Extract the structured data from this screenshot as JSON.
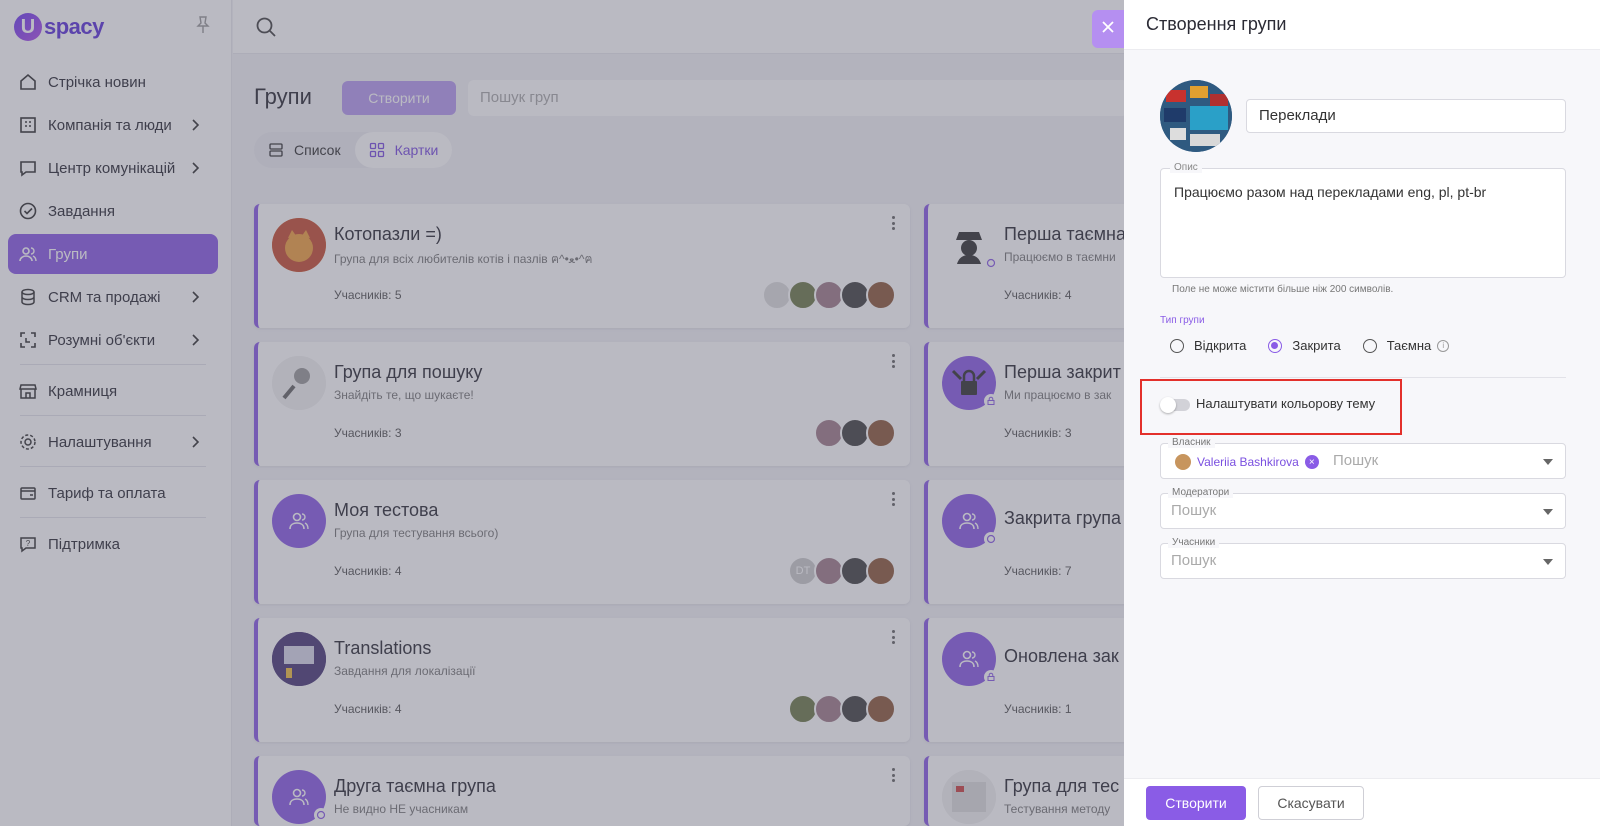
{
  "app": {
    "logo_letter": "U",
    "logo_text": "spacy"
  },
  "sidebar": {
    "items": [
      {
        "label": "Стрічка новин",
        "icon": "home-icon",
        "chevron": false
      },
      {
        "label": "Компанія та люди",
        "icon": "building-icon",
        "chevron": true
      },
      {
        "label": "Центр комунікацій",
        "icon": "chat-icon",
        "chevron": true
      },
      {
        "label": "Завдання",
        "icon": "check-circle-icon",
        "chevron": false
      },
      {
        "label": "Групи",
        "icon": "users-icon",
        "chevron": false,
        "active": true
      },
      {
        "label": "CRM та продажі",
        "icon": "database-icon",
        "chevron": true
      },
      {
        "label": "Розумні об'єкти",
        "icon": "smart-object-icon",
        "chevron": true
      },
      {
        "label": "Крамниця",
        "icon": "store-icon",
        "chevron": false
      },
      {
        "label": "Налаштування",
        "icon": "gear-icon",
        "chevron": true
      },
      {
        "label": "Тариф та оплата",
        "icon": "wallet-icon",
        "chevron": false
      },
      {
        "label": "Підтримка",
        "icon": "help-icon",
        "chevron": false
      }
    ]
  },
  "main": {
    "title": "Групи",
    "create_label": "Створити",
    "search_placeholder": "Пошук груп",
    "views": {
      "list": "Список",
      "cards": "Картки"
    },
    "cards": [
      {
        "title": "Котопазли =)",
        "desc": "Група для всіх любителів котів і пазлів ฅ^•ﻌ•^ฅ",
        "members": "Учасників: 5"
      },
      {
        "title": "Перша таємна",
        "desc": "Працюємо в таємни",
        "members": "Учасників: 4"
      },
      {
        "title": "Група для пошуку",
        "desc": "Знайдіть те, що шукаєте!",
        "members": "Учасників: 3"
      },
      {
        "title": "Перша закрит",
        "desc": "Ми працюємо в зак",
        "members": "Учасників: 3"
      },
      {
        "title": "Моя тестова",
        "desc": "Група для тестування всього)",
        "members": "Учасників: 4"
      },
      {
        "title": "Закрита група",
        "desc": "",
        "members": "Учасників: 7"
      },
      {
        "title": "Translations",
        "desc": "Завдання для локалізації",
        "members": "Учасників: 4"
      },
      {
        "title": "Оновлена зак",
        "desc": "",
        "members": "Учасників: 1"
      },
      {
        "title": "Друга таємна група",
        "desc": "Не видно НЕ учасникам",
        "members": ""
      },
      {
        "title": "Група для тес",
        "desc": "Тестування методу",
        "members": ""
      }
    ],
    "dt_initials": "DT"
  },
  "panel": {
    "title": "Створення групи",
    "name_value": "Переклади",
    "desc_label": "Опис",
    "desc_value": "Працюємо разом над перекладами eng, pl, pt-br",
    "desc_hint": "Поле не може містити більше ніж 200 символів.",
    "type_label": "Тип групи",
    "types": [
      "Відкрита",
      "Закрита",
      "Таємна"
    ],
    "type_selected": "Закрита",
    "theme_toggle_label": "Налаштувати кольорову тему",
    "theme_toggle_on": false,
    "owner_label": "Власник",
    "owner_name": "Valeriia Bashkirova",
    "owner_placeholder": "Пошук",
    "moderators_label": "Модератори",
    "moderators_placeholder": "Пошук",
    "members_label": "Учасники",
    "members_placeholder": "Пошук",
    "submit_label": "Створити",
    "cancel_label": "Скасувати"
  },
  "colors": {
    "accent": "#8a5ce6",
    "highlight": "#e3302b"
  }
}
